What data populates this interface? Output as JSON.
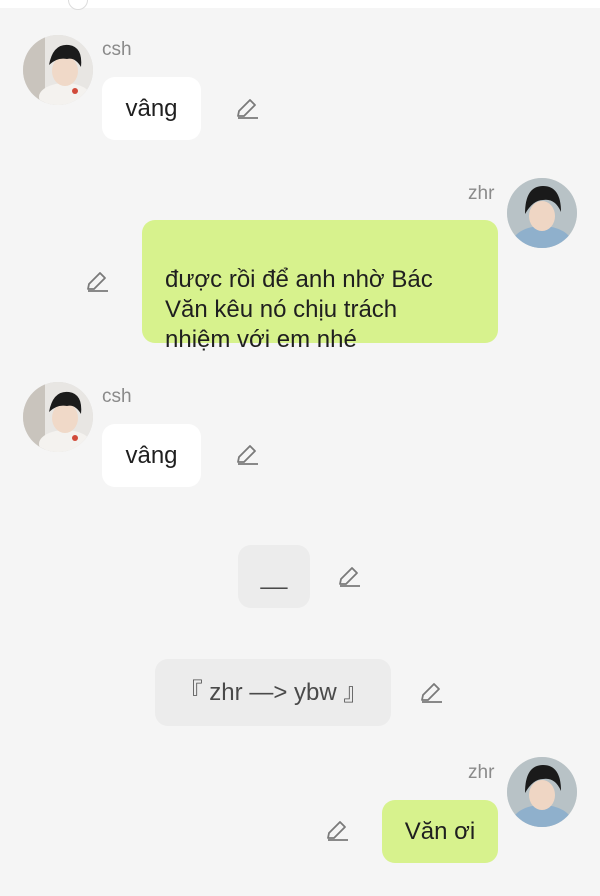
{
  "messages": [
    {
      "sender": "csh",
      "text": "vâng"
    },
    {
      "sender": "zhr",
      "text": "được rồi để anh nhờ Bác\nVăn kêu nó chịu trách\nnhiệm với em nhé"
    },
    {
      "sender": "csh",
      "text": "vâng"
    },
    {
      "text": "__"
    },
    {
      "text": "『 zhr —> ybw 』"
    },
    {
      "sender": "zhr",
      "text": "Văn ơi"
    }
  ],
  "icons": {
    "edit": "pencil-edit-icon",
    "avatar_csh": "avatar-csh",
    "avatar_zhr": "avatar-zhr"
  },
  "colors": {
    "background": "#f5f5f5",
    "incoming_bubble": "#ffffff",
    "outgoing_bubble": "#d7f28d",
    "narration_bubble": "#ececec"
  }
}
